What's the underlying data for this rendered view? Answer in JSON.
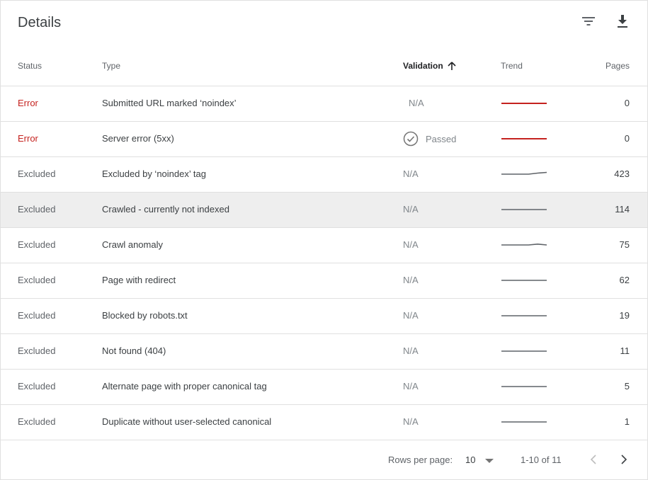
{
  "header": {
    "title": "Details"
  },
  "columns": {
    "status": "Status",
    "type": "Type",
    "validation": "Validation",
    "trend": "Trend",
    "pages": "Pages"
  },
  "colors": {
    "error": "#c5221f",
    "trend_error": "#c5221f",
    "trend_normal": "#5f6368"
  },
  "rows": [
    {
      "status": "Error",
      "type": "Submitted URL marked ‘noindex’",
      "validation": "N/A",
      "pages": "0",
      "trend": [
        0,
        0,
        0,
        0,
        0,
        0
      ],
      "trend_kind": "error",
      "validation_offset": 8
    },
    {
      "status": "Error",
      "type": "Server error (5xx)",
      "validation": "Passed",
      "validation_icon": "check-circle-icon",
      "pages": "0",
      "trend": [
        0,
        0,
        0,
        0,
        0,
        0
      ],
      "trend_kind": "error"
    },
    {
      "status": "Excluded",
      "type": "Excluded by ‘noindex’ tag",
      "validation": "N/A",
      "pages": "423",
      "trend": [
        0,
        0,
        0,
        0,
        0.6,
        1
      ],
      "trend_kind": "normal"
    },
    {
      "status": "Excluded",
      "type": "Crawled - currently not indexed",
      "validation": "N/A",
      "pages": "114",
      "trend": [
        0,
        0,
        0,
        0,
        0,
        0
      ],
      "trend_kind": "normal",
      "highlight": true
    },
    {
      "status": "Excluded",
      "type": "Crawl anomaly",
      "validation": "N/A",
      "pages": "75",
      "trend": [
        0,
        0,
        0,
        0,
        0.5,
        0
      ],
      "trend_kind": "normal"
    },
    {
      "status": "Excluded",
      "type": "Page with redirect",
      "validation": "N/A",
      "pages": "62",
      "trend": [
        0,
        0,
        0,
        0,
        0,
        0
      ],
      "trend_kind": "normal"
    },
    {
      "status": "Excluded",
      "type": "Blocked by robots.txt",
      "validation": "N/A",
      "pages": "19",
      "trend": [
        0,
        0,
        0,
        0,
        0,
        0
      ],
      "trend_kind": "normal"
    },
    {
      "status": "Excluded",
      "type": "Not found (404)",
      "validation": "N/A",
      "pages": "11",
      "trend": [
        0,
        0,
        0,
        0,
        0,
        0
      ],
      "trend_kind": "normal"
    },
    {
      "status": "Excluded",
      "type": "Alternate page with proper canonical tag",
      "validation": "N/A",
      "pages": "5",
      "trend": [
        0,
        0,
        0,
        0,
        0,
        0
      ],
      "trend_kind": "normal"
    },
    {
      "status": "Excluded",
      "type": "Duplicate without user-selected canonical",
      "validation": "N/A",
      "pages": "1",
      "trend": [
        0,
        0,
        0,
        0,
        0,
        0
      ],
      "trend_kind": "normal"
    }
  ],
  "footer": {
    "rows_per_page_label": "Rows per page:",
    "rows_per_page_value": "10",
    "range": "1-10 of 11"
  }
}
